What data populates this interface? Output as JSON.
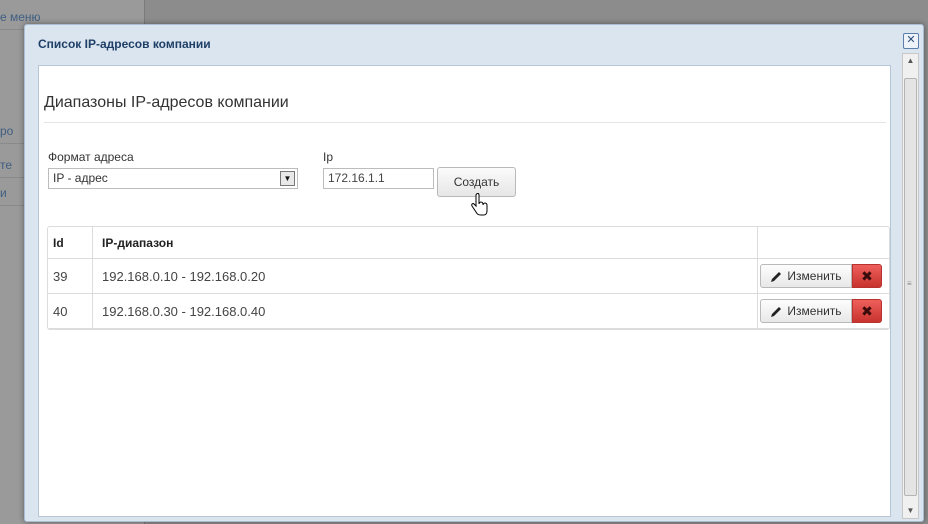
{
  "background": {
    "menu_items": [
      "е меню",
      "ро",
      "те",
      "и"
    ]
  },
  "dialog": {
    "title": "Список IP-адресов компании",
    "close_icon": "close-icon"
  },
  "section": {
    "title": "Диапазоны IP-адресов компании"
  },
  "form": {
    "format_label": "Формат адреса",
    "format_selected": "IP - адрес",
    "ip_label": "Ip",
    "ip_value": "172.16.1.1",
    "create_label": "Создать"
  },
  "table": {
    "headers": {
      "id": "Id",
      "range": "IP-диапазон"
    },
    "rows": [
      {
        "id": "39",
        "range": "192.168.0.10 - 192.168.0.20",
        "edit_label": "Изменить"
      },
      {
        "id": "40",
        "range": "192.168.0.30 - 192.168.0.40",
        "edit_label": "Изменить"
      }
    ]
  },
  "colors": {
    "dialog_header_bg": "#dbe5f0",
    "title_color": "#1e3f66",
    "delete_button": "#da4f49"
  }
}
